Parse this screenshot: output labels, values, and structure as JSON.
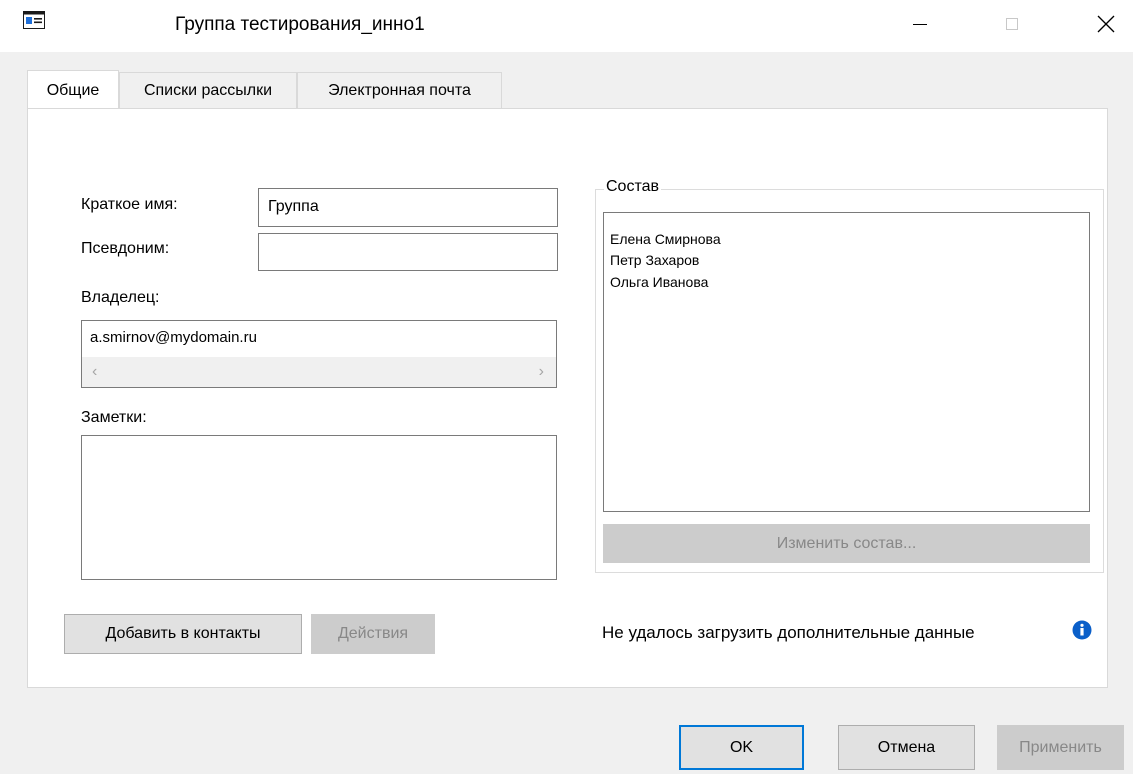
{
  "window": {
    "title": "Группа тестирования_инно1",
    "icons": {
      "app": "contact-card-icon",
      "minimize": "minimize-icon",
      "maximize": "maximize-icon",
      "close": "close-icon"
    }
  },
  "tabs": [
    {
      "label": "Общие",
      "active": true
    },
    {
      "label": "Списки рассылки",
      "active": false
    },
    {
      "label": "Электронная почта",
      "active": false
    }
  ],
  "general": {
    "short_name_label": "Краткое имя:",
    "short_name_value": "Группа",
    "alias_label": "Псевдоним:",
    "alias_value": "",
    "owner_label": "Владелец:",
    "owner_value": "a.smirnov@mydomain.ru",
    "notes_label": "Заметки:",
    "notes_value": ""
  },
  "membership": {
    "legend": "Состав",
    "members": [
      "Елена Смирнова",
      "Петр Захаров",
      "Ольга Иванова"
    ],
    "modify_button": "Изменить состав..."
  },
  "actions": {
    "add_to_contacts": "Добавить в контакты",
    "actions_button": "Действия",
    "status_text": "Не удалось загрузить дополнительные данные",
    "status_icon": "info-icon"
  },
  "footer": {
    "ok": "OK",
    "cancel": "Отмена",
    "apply": "Применить"
  },
  "colors": {
    "accent": "#0078d7",
    "info_icon": "#0a5fc9",
    "disabled_bg": "#cccccc",
    "disabled_text": "#888888"
  }
}
